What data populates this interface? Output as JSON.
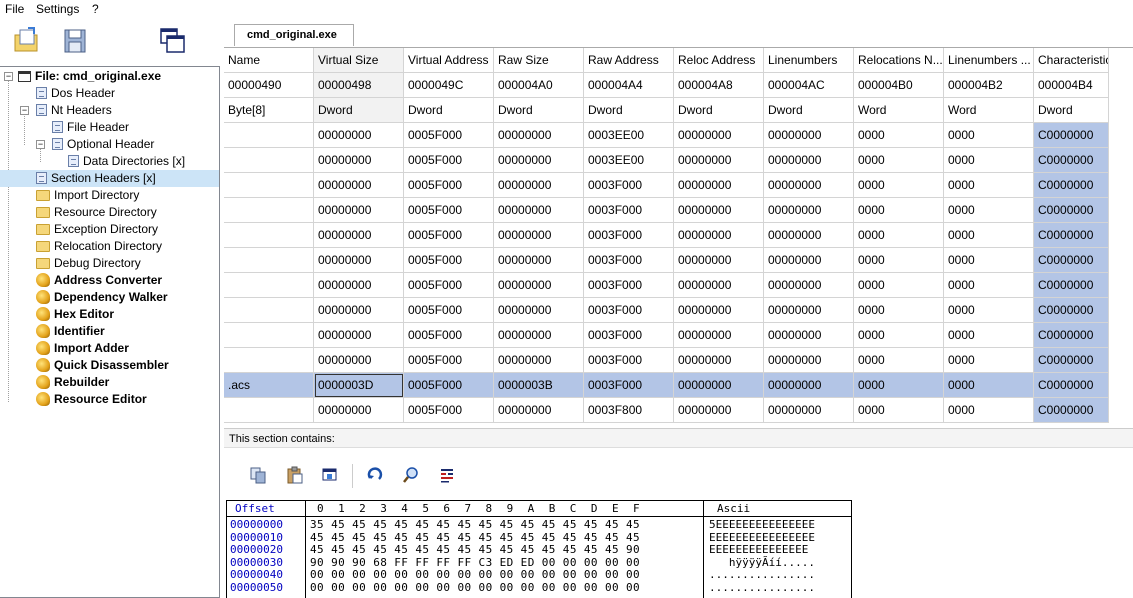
{
  "menu": [
    "File",
    "Settings",
    "?"
  ],
  "tab_title": "cmd_original.exe",
  "tree": [
    {
      "label": "File: cmd_original.exe",
      "icon": "window-icon",
      "bold": true,
      "level": 0
    },
    {
      "label": "Dos Header",
      "icon": "doc-icon",
      "level": 1
    },
    {
      "label": "Nt Headers",
      "icon": "doc-icon",
      "level": 1
    },
    {
      "label": "File Header",
      "icon": "doc-icon",
      "level": 2
    },
    {
      "label": "Optional Header",
      "icon": "doc-icon",
      "level": 2
    },
    {
      "label": "Data Directories [x]",
      "icon": "doc-icon",
      "level": 3
    },
    {
      "label": "Section Headers [x]",
      "icon": "doc-icon",
      "level": 1,
      "selected": true
    },
    {
      "label": "Import Directory",
      "icon": "folder-icon",
      "level": 1
    },
    {
      "label": "Resource Directory",
      "icon": "folder-icon",
      "level": 1
    },
    {
      "label": "Exception Directory",
      "icon": "folder-icon",
      "level": 1
    },
    {
      "label": "Relocation Directory",
      "icon": "folder-icon",
      "level": 1
    },
    {
      "label": "Debug Directory",
      "icon": "folder-icon",
      "level": 1
    },
    {
      "label": "Address Converter",
      "icon": "tool-icon",
      "bold": true,
      "level": 1
    },
    {
      "label": "Dependency Walker",
      "icon": "tool-icon",
      "bold": true,
      "level": 1
    },
    {
      "label": "Hex Editor",
      "icon": "tool-icon",
      "bold": true,
      "level": 1
    },
    {
      "label": "Identifier",
      "icon": "tool-icon",
      "bold": true,
      "level": 1
    },
    {
      "label": "Import Adder",
      "icon": "tool-icon",
      "bold": true,
      "level": 1
    },
    {
      "label": "Quick Disassembler",
      "icon": "tool-icon",
      "bold": true,
      "level": 1
    },
    {
      "label": "Rebuilder",
      "icon": "tool-icon",
      "bold": true,
      "level": 1
    },
    {
      "label": "Resource Editor",
      "icon": "tool-icon",
      "bold": true,
      "level": 1
    }
  ],
  "grid": {
    "columns": [
      "Name",
      "Virtual Size",
      "Virtual Address",
      "Raw Size",
      "Raw Address",
      "Reloc Address",
      "Linenumbers",
      "Relocations N...",
      "Linenumbers ...",
      "Characteristics"
    ],
    "offsets": [
      "00000490",
      "00000498",
      "0000049C",
      "000004A0",
      "000004A4",
      "000004A8",
      "000004AC",
      "000004B0",
      "000004B2",
      "000004B4"
    ],
    "types": [
      "Byte[8]",
      "Dword",
      "Dword",
      "Dword",
      "Dword",
      "Dword",
      "Dword",
      "Word",
      "Word",
      "Dword"
    ],
    "rows": [
      [
        "",
        "00000000",
        "0005F000",
        "00000000",
        "0003EE00",
        "00000000",
        "00000000",
        "0000",
        "0000",
        "C0000000"
      ],
      [
        "",
        "00000000",
        "0005F000",
        "00000000",
        "0003EE00",
        "00000000",
        "00000000",
        "0000",
        "0000",
        "C0000000"
      ],
      [
        "",
        "00000000",
        "0005F000",
        "00000000",
        "0003F000",
        "00000000",
        "00000000",
        "0000",
        "0000",
        "C0000000"
      ],
      [
        "",
        "00000000",
        "0005F000",
        "00000000",
        "0003F000",
        "00000000",
        "00000000",
        "0000",
        "0000",
        "C0000000"
      ],
      [
        "",
        "00000000",
        "0005F000",
        "00000000",
        "0003F000",
        "00000000",
        "00000000",
        "0000",
        "0000",
        "C0000000"
      ],
      [
        "",
        "00000000",
        "0005F000",
        "00000000",
        "0003F000",
        "00000000",
        "00000000",
        "0000",
        "0000",
        "C0000000"
      ],
      [
        "",
        "00000000",
        "0005F000",
        "00000000",
        "0003F000",
        "00000000",
        "00000000",
        "0000",
        "0000",
        "C0000000"
      ],
      [
        "",
        "00000000",
        "0005F000",
        "00000000",
        "0003F000",
        "00000000",
        "00000000",
        "0000",
        "0000",
        "C0000000"
      ],
      [
        "",
        "00000000",
        "0005F000",
        "00000000",
        "0003F000",
        "00000000",
        "00000000",
        "0000",
        "0000",
        "C0000000"
      ],
      [
        "",
        "00000000",
        "0005F000",
        "00000000",
        "0003F000",
        "00000000",
        "00000000",
        "0000",
        "0000",
        "C0000000"
      ],
      [
        ".acs",
        "0000003D",
        "0005F000",
        "0000003B",
        "0003F000",
        "00000000",
        "00000000",
        "0000",
        "0000",
        "C0000000"
      ],
      [
        "",
        "00000000",
        "0005F000",
        "00000000",
        "0003F800",
        "00000000",
        "00000000",
        "0000",
        "0000",
        "C0000000"
      ]
    ],
    "selected_row": 10
  },
  "section_contains_label": "This section contains:",
  "hex": {
    "header_offset": "Offset",
    "header_bytes": "0  1  2  3  4  5  6  7  8  9  A  B  C  D  E  F",
    "header_ascii": "Ascii",
    "rows": [
      {
        "offset": "00000000",
        "bytes": "35 45 45 45 45 45 45 45 45 45 45 45 45 45 45 45",
        "ascii": "5EEEEEEEEEEEEEEE"
      },
      {
        "offset": "00000010",
        "bytes": "45 45 45 45 45 45 45 45 45 45 45 45 45 45 45 45",
        "ascii": "EEEEEEEEEEEEEEEE"
      },
      {
        "offset": "00000020",
        "bytes": "45 45 45 45 45 45 45 45 45 45 45 45 45 45 45 90",
        "ascii": "EEEEEEEEEEEEEEE"
      },
      {
        "offset": "00000030",
        "bytes": "90 90 90 68 FF FF FF FF C3 ED ED 00 00 00 00 00",
        "ascii": "   hÿÿÿÿÃíí....."
      },
      {
        "offset": "00000040",
        "bytes": "00 00 00 00 00 00 00 00 00 00 00 00 00 00 00 00",
        "ascii": "................"
      },
      {
        "offset": "00000050",
        "bytes": "00 00 00 00 00 00 00 00 00 00 00 00 00 00 00 00",
        "ascii": "................"
      }
    ]
  }
}
